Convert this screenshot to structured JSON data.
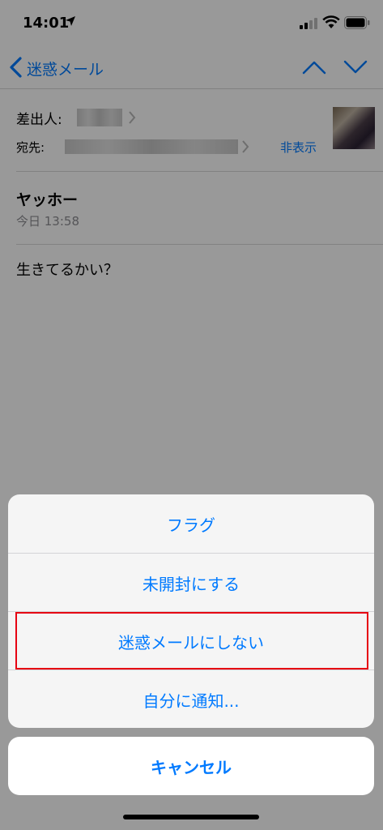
{
  "status": {
    "time": "14:01"
  },
  "nav": {
    "back_label": "迷惑メール"
  },
  "header": {
    "sender_label": "差出人:",
    "to_label": "宛先:",
    "hide_label": "非表示"
  },
  "message": {
    "subject": "ヤッホー",
    "date": "今日 13:58",
    "body": "生きてるかい？"
  },
  "action_sheet": {
    "items": [
      {
        "label": "フラグ"
      },
      {
        "label": "未開封にする"
      },
      {
        "label": "迷惑メールにしない"
      },
      {
        "label": "自分に通知..."
      }
    ],
    "cancel_label": "キャンセル"
  },
  "colors": {
    "accent": "#007aff",
    "highlight": "#e60012",
    "overlay": "rgba(0,0,0,0.40)"
  },
  "icons": [
    "location-arrow-icon",
    "cellular-signal-icon",
    "wifi-icon",
    "battery-icon",
    "back-chevron-icon",
    "chevron-up-icon",
    "chevron-down-icon",
    "chevron-right-icon"
  ]
}
